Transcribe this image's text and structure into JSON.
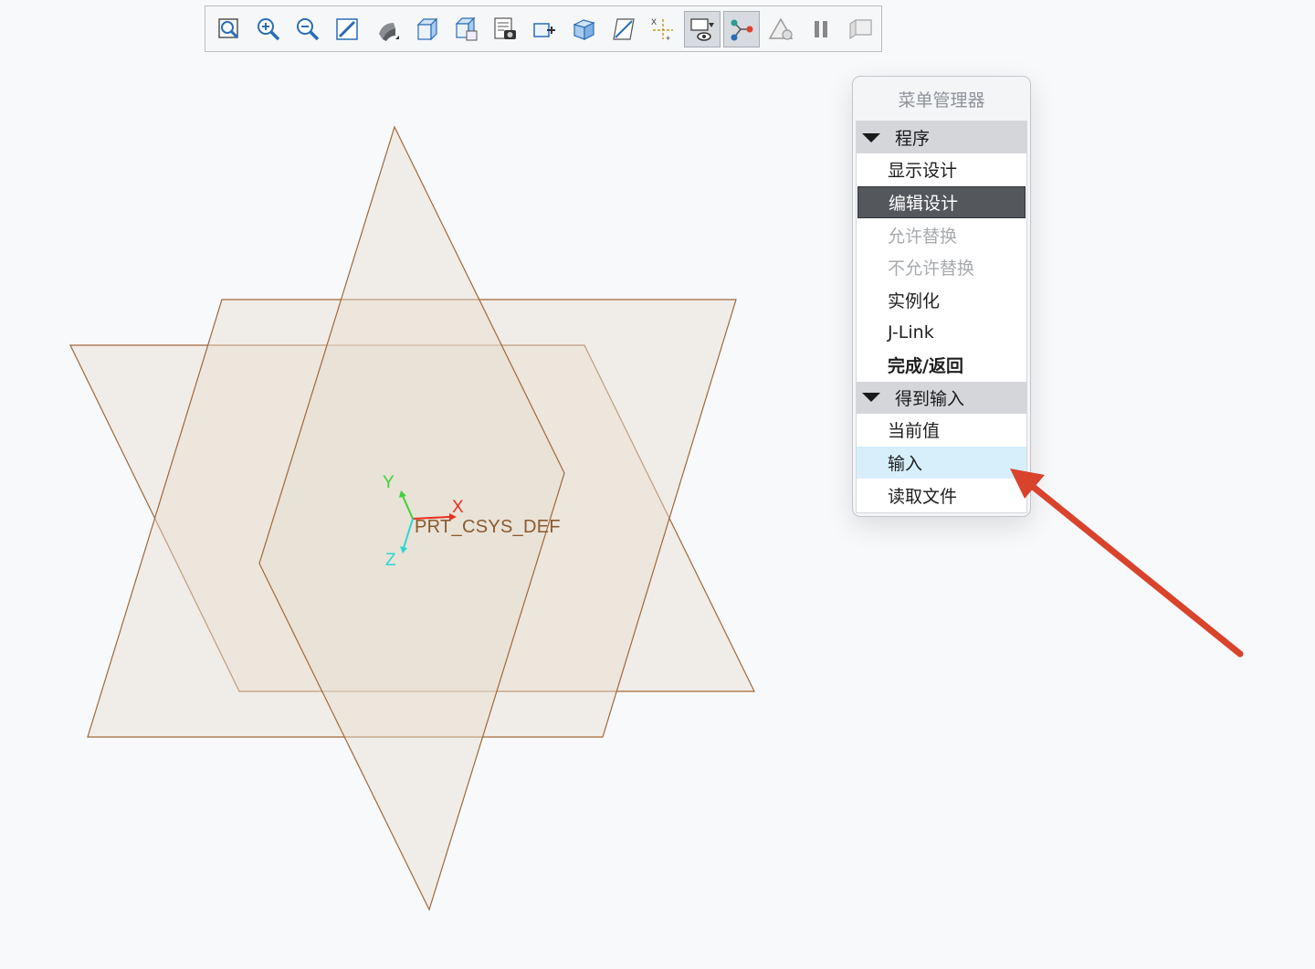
{
  "toolbar": {
    "buttons": [
      {
        "icon": "refit-icon"
      },
      {
        "icon": "zoom-in-icon"
      },
      {
        "icon": "zoom-out-icon"
      },
      {
        "icon": "repaint-icon"
      },
      {
        "icon": "display-style-icon"
      },
      {
        "icon": "saved-orientations-icon"
      },
      {
        "icon": "named-views-icon"
      },
      {
        "icon": "view-manager-icon"
      },
      {
        "icon": "section-icon"
      },
      {
        "icon": "perspective-icon"
      },
      {
        "icon": "datum-display-icon"
      },
      {
        "icon": "annotation-display-icon"
      },
      {
        "icon": "visibility-filter-icon",
        "pressed": true
      },
      {
        "icon": "spin-center-icon",
        "pressed": true
      },
      {
        "icon": "tolerance-icon"
      },
      {
        "icon": "pause-icon"
      },
      {
        "icon": "stop-icon"
      }
    ]
  },
  "viewport": {
    "csys_label": "PRT_CSYS_DEF",
    "axes": {
      "x": "X",
      "y": "Y",
      "z": "Z"
    },
    "colors": {
      "plane_fill": "#e8e0d5",
      "plane_edge": "#a0683a",
      "x_axis": "#e8301f",
      "y_axis": "#3dd13d",
      "z_axis": "#2ad6d6"
    }
  },
  "menu_manager": {
    "title": "菜单管理器",
    "sections": [
      {
        "header": "程序",
        "items": [
          {
            "label": "显示设计",
            "state": "normal"
          },
          {
            "label": "编辑设计",
            "state": "selected"
          },
          {
            "label": "允许替换",
            "state": "disabled"
          },
          {
            "label": "不允许替换",
            "state": "disabled"
          },
          {
            "label": "实例化",
            "state": "normal"
          },
          {
            "label": "J-Link",
            "state": "normal"
          },
          {
            "label": "完成/返回",
            "state": "bold"
          }
        ]
      },
      {
        "header": "得到输入",
        "items": [
          {
            "label": "当前值",
            "state": "normal"
          },
          {
            "label": "输入",
            "state": "hover"
          },
          {
            "label": "读取文件",
            "state": "normal"
          }
        ]
      }
    ]
  },
  "annotation": {
    "arrow_color": "#d9432c"
  }
}
